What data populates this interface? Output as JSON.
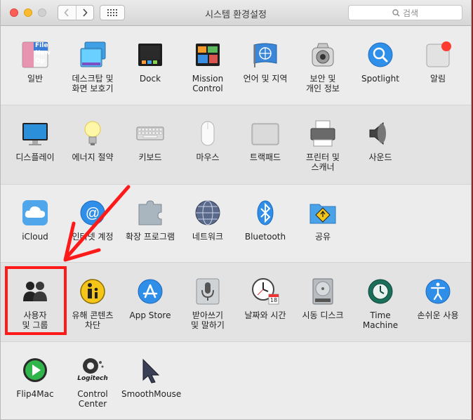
{
  "window": {
    "title": "시스템 환경설정",
    "search_placeholder": "검색"
  },
  "rows": [
    [
      {
        "label": "일반",
        "icon": "general-icon"
      },
      {
        "label": "데스크탑 및\n화면 보호기",
        "icon": "desktop-screensaver-icon"
      },
      {
        "label": "Dock",
        "icon": "dock-icon"
      },
      {
        "label": "Mission\nControl",
        "icon": "mission-control-icon"
      },
      {
        "label": "언어 및 지역",
        "icon": "language-region-icon"
      },
      {
        "label": "보안 및\n개인 정보",
        "icon": "security-privacy-icon"
      },
      {
        "label": "Spotlight",
        "icon": "spotlight-icon"
      },
      {
        "label": "알림",
        "icon": "notifications-icon"
      }
    ],
    [
      {
        "label": "디스플레이",
        "icon": "displays-icon"
      },
      {
        "label": "에너지 절약",
        "icon": "energy-saver-icon"
      },
      {
        "label": "키보드",
        "icon": "keyboard-icon"
      },
      {
        "label": "마우스",
        "icon": "mouse-icon"
      },
      {
        "label": "트랙패드",
        "icon": "trackpad-icon"
      },
      {
        "label": "프린터 및\n스캐너",
        "icon": "printer-icon"
      },
      {
        "label": "사운드",
        "icon": "sound-icon"
      }
    ],
    [
      {
        "label": "iCloud",
        "icon": "icloud-icon"
      },
      {
        "label": "인터넷 계정",
        "icon": "internet-accounts-icon"
      },
      {
        "label": "확장 프로그램",
        "icon": "extensions-icon"
      },
      {
        "label": "네트워크",
        "icon": "network-icon"
      },
      {
        "label": "Bluetooth",
        "icon": "bluetooth-icon"
      },
      {
        "label": "공유",
        "icon": "sharing-icon"
      }
    ],
    [
      {
        "label": "사용자\n및 그룹",
        "icon": "users-groups-icon"
      },
      {
        "label": "유해 콘텐츠\n차단",
        "icon": "parental-controls-icon"
      },
      {
        "label": "App Store",
        "icon": "app-store-icon"
      },
      {
        "label": "받아쓰기\n및 말하기",
        "icon": "dictation-speech-icon"
      },
      {
        "label": "날짜와 시간",
        "icon": "date-time-icon"
      },
      {
        "label": "시동 디스크",
        "icon": "startup-disk-icon"
      },
      {
        "label": "Time Machine",
        "icon": "time-machine-icon"
      },
      {
        "label": "손쉬운 사용",
        "icon": "accessibility-icon"
      }
    ],
    [
      {
        "label": "Flip4Mac",
        "icon": "flip4mac-icon"
      },
      {
        "label": "Control Center",
        "icon": "logitech-control-center-icon"
      },
      {
        "label": "SmoothMouse",
        "icon": "smoothmouse-icon"
      }
    ]
  ],
  "icon_texts": {
    "general": "File\nNew\nOp",
    "logitech": "Logitech",
    "calendar_day": "18"
  },
  "annotation": {
    "color": "#ff1a1a"
  }
}
